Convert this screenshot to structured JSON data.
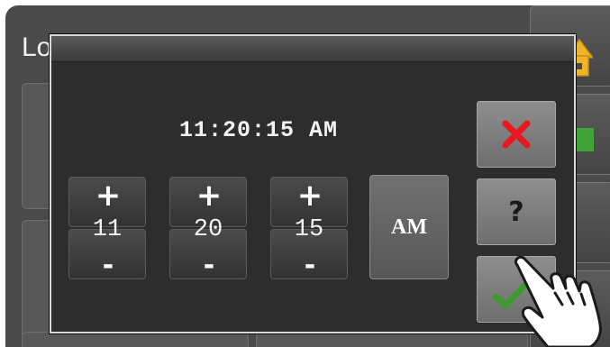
{
  "background": {
    "title_partial": "Lo"
  },
  "dialog": {
    "time_display": "11:20:15 AM",
    "spinners": [
      {
        "name": "hour",
        "value": "11",
        "up_label": "+",
        "down_label": "-"
      },
      {
        "name": "minute",
        "value": "20",
        "up_label": "+",
        "down_label": "-"
      },
      {
        "name": "second",
        "value": "15",
        "up_label": "+",
        "down_label": "-"
      }
    ],
    "ampm_label": "AM",
    "help_label": "?"
  },
  "icons": {
    "cancel": "x-icon",
    "help": "question-icon",
    "confirm": "check-icon",
    "background_home": "home-icon",
    "pointer": "hand-pointer-icon"
  },
  "colors": {
    "cancel_red": "#e8191e",
    "confirm_green": "#3e9a2e",
    "home_yellow": "#f0b429",
    "status_green": "#3fa335"
  }
}
